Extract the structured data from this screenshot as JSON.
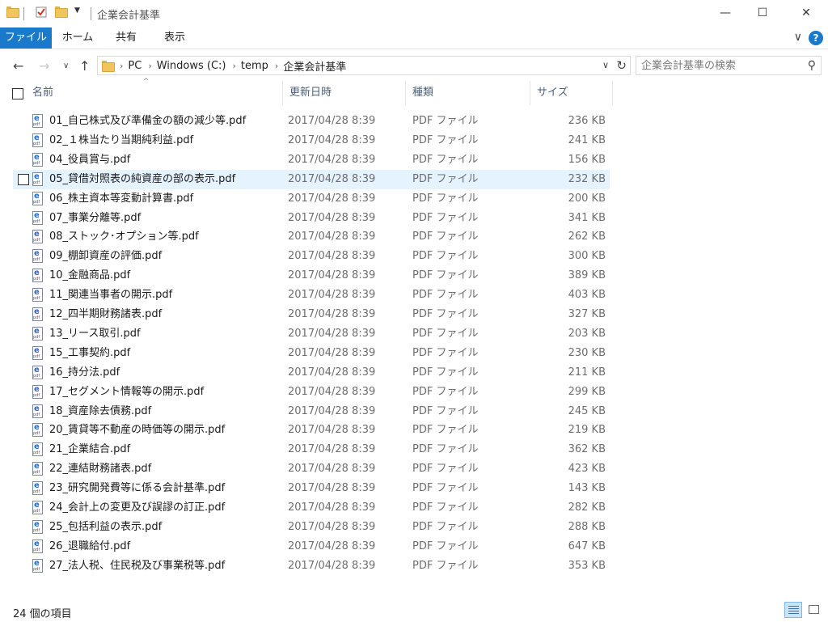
{
  "window": {
    "title": "企業会計基準",
    "minimize_glyph": "—",
    "maximize_glyph": "☐",
    "close_glyph": "✕"
  },
  "ribbon": {
    "tabs": [
      "ファイル",
      "ホーム",
      "共有",
      "表示"
    ],
    "help_glyph": "?",
    "expand_glyph": "∨"
  },
  "nav": {
    "back_glyph": "←",
    "forward_glyph": "→",
    "recent_glyph": "∨",
    "up_glyph": "↑",
    "breadcrumb": [
      "PC",
      "Windows (C:)",
      "temp",
      "企業会計基準"
    ],
    "crumb_sep": "›",
    "dropdown_glyph": "∨",
    "refresh_glyph": "↻",
    "search_placeholder": "企業会計基準の検索",
    "search_glyph": "⚲"
  },
  "columns": {
    "name": "名前",
    "date": "更新日時",
    "type": "種類",
    "size": "サイズ",
    "sort_glyph": "^"
  },
  "files": [
    {
      "name": "01_自己株式及び準備金の額の減少等.pdf",
      "date": "2017/04/28 8:39",
      "type": "PDF ファイル",
      "size": "236 KB"
    },
    {
      "name": "02_１株当たり当期純利益.pdf",
      "date": "2017/04/28 8:39",
      "type": "PDF ファイル",
      "size": "241 KB"
    },
    {
      "name": "04_役員賞与.pdf",
      "date": "2017/04/28 8:39",
      "type": "PDF ファイル",
      "size": "156 KB"
    },
    {
      "name": "05_貸借対照表の純資産の部の表示.pdf",
      "date": "2017/04/28 8:39",
      "type": "PDF ファイル",
      "size": "232 KB"
    },
    {
      "name": "06_株主資本等変動計算書.pdf",
      "date": "2017/04/28 8:39",
      "type": "PDF ファイル",
      "size": "200 KB"
    },
    {
      "name": "07_事業分離等.pdf",
      "date": "2017/04/28 8:39",
      "type": "PDF ファイル",
      "size": "341 KB"
    },
    {
      "name": "08_ストック･オプション等.pdf",
      "date": "2017/04/28 8:39",
      "type": "PDF ファイル",
      "size": "262 KB"
    },
    {
      "name": "09_棚卸資産の評価.pdf",
      "date": "2017/04/28 8:39",
      "type": "PDF ファイル",
      "size": "300 KB"
    },
    {
      "name": "10_金融商品.pdf",
      "date": "2017/04/28 8:39",
      "type": "PDF ファイル",
      "size": "389 KB"
    },
    {
      "name": "11_関連当事者の開示.pdf",
      "date": "2017/04/28 8:39",
      "type": "PDF ファイル",
      "size": "403 KB"
    },
    {
      "name": "12_四半期財務諸表.pdf",
      "date": "2017/04/28 8:39",
      "type": "PDF ファイル",
      "size": "327 KB"
    },
    {
      "name": "13_リース取引.pdf",
      "date": "2017/04/28 8:39",
      "type": "PDF ファイル",
      "size": "203 KB"
    },
    {
      "name": "15_工事契約.pdf",
      "date": "2017/04/28 8:39",
      "type": "PDF ファイル",
      "size": "230 KB"
    },
    {
      "name": "16_持分法.pdf",
      "date": "2017/04/28 8:39",
      "type": "PDF ファイル",
      "size": "211 KB"
    },
    {
      "name": "17_セグメント情報等の開示.pdf",
      "date": "2017/04/28 8:39",
      "type": "PDF ファイル",
      "size": "299 KB"
    },
    {
      "name": "18_資産除去債務.pdf",
      "date": "2017/04/28 8:39",
      "type": "PDF ファイル",
      "size": "245 KB"
    },
    {
      "name": "20_賃貸等不動産の時価等の開示.pdf",
      "date": "2017/04/28 8:39",
      "type": "PDF ファイル",
      "size": "219 KB"
    },
    {
      "name": "21_企業結合.pdf",
      "date": "2017/04/28 8:39",
      "type": "PDF ファイル",
      "size": "362 KB"
    },
    {
      "name": "22_連結財務諸表.pdf",
      "date": "2017/04/28 8:39",
      "type": "PDF ファイル",
      "size": "423 KB"
    },
    {
      "name": "23_研究開発費等に係る会計基準.pdf",
      "date": "2017/04/28 8:39",
      "type": "PDF ファイル",
      "size": "143 KB"
    },
    {
      "name": "24_会計上の変更及び誤謬の訂正.pdf",
      "date": "2017/04/28 8:39",
      "type": "PDF ファイル",
      "size": "282 KB"
    },
    {
      "name": "25_包括利益の表示.pdf",
      "date": "2017/04/28 8:39",
      "type": "PDF ファイル",
      "size": "288 KB"
    },
    {
      "name": "26_退職給付.pdf",
      "date": "2017/04/28 8:39",
      "type": "PDF ファイル",
      "size": "647 KB"
    },
    {
      "name": "27_法人税、住民税及び事業税等.pdf",
      "date": "2017/04/28 8:39",
      "type": "PDF ファイル",
      "size": "353 KB"
    }
  ],
  "hovered_row": 3,
  "file_icon": {
    "glyph": "e",
    "label": "pdf"
  },
  "status": {
    "item_count": "24 個の項目"
  },
  "colors": {
    "accent": "#1979ca",
    "hover_row": "#e5f3ff",
    "header_text": "#4c607a"
  }
}
